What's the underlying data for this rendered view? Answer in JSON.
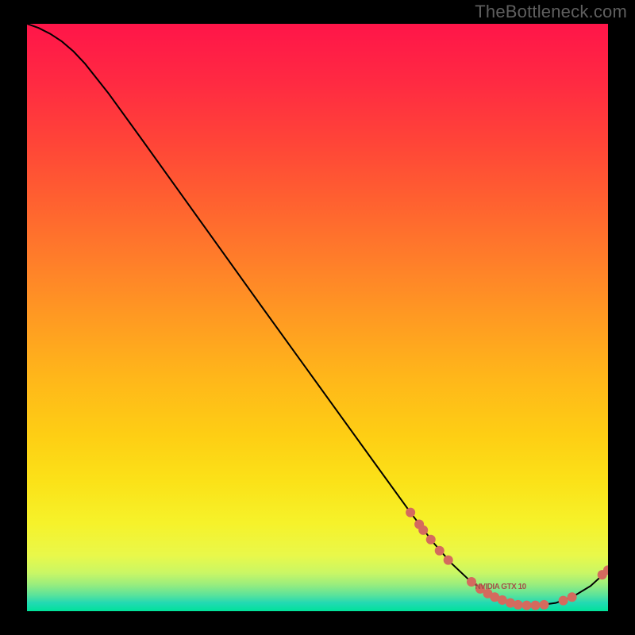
{
  "watermark": "TheBottleneck.com",
  "chart_data": {
    "type": "line",
    "title": "",
    "xlabel": "",
    "ylabel": "",
    "xlim": [
      0,
      100
    ],
    "ylim": [
      0,
      100
    ],
    "grid": false,
    "curve": [
      {
        "x": 0,
        "y": 100
      },
      {
        "x": 2,
        "y": 99.3
      },
      {
        "x": 4,
        "y": 98.3
      },
      {
        "x": 6,
        "y": 97.0
      },
      {
        "x": 8,
        "y": 95.3
      },
      {
        "x": 10,
        "y": 93.2
      },
      {
        "x": 14,
        "y": 88.2
      },
      {
        "x": 20,
        "y": 80.0
      },
      {
        "x": 30,
        "y": 66.2
      },
      {
        "x": 40,
        "y": 52.4
      },
      {
        "x": 50,
        "y": 38.7
      },
      {
        "x": 60,
        "y": 25.0
      },
      {
        "x": 66,
        "y": 16.8
      },
      {
        "x": 70,
        "y": 11.6
      },
      {
        "x": 73,
        "y": 8.2
      },
      {
        "x": 76,
        "y": 5.4
      },
      {
        "x": 79,
        "y": 3.2
      },
      {
        "x": 82,
        "y": 1.8
      },
      {
        "x": 85,
        "y": 1.1
      },
      {
        "x": 88,
        "y": 1.0
      },
      {
        "x": 91,
        "y": 1.4
      },
      {
        "x": 94,
        "y": 2.5
      },
      {
        "x": 97,
        "y": 4.3
      },
      {
        "x": 100,
        "y": 7.0
      }
    ],
    "dot_clusters": [
      {
        "cx": 66.0,
        "cy": 16.8,
        "r": 6
      },
      {
        "cx": 67.5,
        "cy": 14.8,
        "r": 6
      },
      {
        "cx": 68.2,
        "cy": 13.8,
        "r": 6
      },
      {
        "cx": 69.5,
        "cy": 12.2,
        "r": 6
      },
      {
        "cx": 71.0,
        "cy": 10.3,
        "r": 6
      },
      {
        "cx": 72.5,
        "cy": 8.7,
        "r": 6
      },
      {
        "cx": 76.5,
        "cy": 5.0,
        "r": 6
      },
      {
        "cx": 78.0,
        "cy": 3.8,
        "r": 6
      },
      {
        "cx": 79.3,
        "cy": 3.0,
        "r": 6
      },
      {
        "cx": 80.5,
        "cy": 2.4,
        "r": 6
      },
      {
        "cx": 81.8,
        "cy": 1.9,
        "r": 6
      },
      {
        "cx": 83.2,
        "cy": 1.4,
        "r": 6
      },
      {
        "cx": 84.5,
        "cy": 1.1,
        "r": 6
      },
      {
        "cx": 86.0,
        "cy": 1.0,
        "r": 6
      },
      {
        "cx": 87.5,
        "cy": 1.0,
        "r": 6
      },
      {
        "cx": 89.0,
        "cy": 1.1,
        "r": 6
      },
      {
        "cx": 92.3,
        "cy": 1.8,
        "r": 6
      },
      {
        "cx": 93.8,
        "cy": 2.4,
        "r": 6
      },
      {
        "cx": 99.0,
        "cy": 6.2,
        "r": 6
      },
      {
        "cx": 100.0,
        "cy": 7.0,
        "r": 6
      }
    ],
    "label_on_curve": {
      "x": 81.5,
      "y": 3.8,
      "text": "NVIDIA GTX 10"
    },
    "gradient_stops": [
      {
        "offset": 0.0,
        "color": "#ff1549"
      },
      {
        "offset": 0.1,
        "color": "#ff2a42"
      },
      {
        "offset": 0.2,
        "color": "#ff4438"
      },
      {
        "offset": 0.3,
        "color": "#ff6030"
      },
      {
        "offset": 0.4,
        "color": "#ff7d2a"
      },
      {
        "offset": 0.5,
        "color": "#ff9a22"
      },
      {
        "offset": 0.6,
        "color": "#ffb61a"
      },
      {
        "offset": 0.7,
        "color": "#fece14"
      },
      {
        "offset": 0.78,
        "color": "#fbe218"
      },
      {
        "offset": 0.85,
        "color": "#f6f22a"
      },
      {
        "offset": 0.905,
        "color": "#e9f84a"
      },
      {
        "offset": 0.935,
        "color": "#c9f765"
      },
      {
        "offset": 0.955,
        "color": "#98ed7e"
      },
      {
        "offset": 0.972,
        "color": "#5de39a"
      },
      {
        "offset": 0.986,
        "color": "#22d9b3"
      },
      {
        "offset": 1.0,
        "color": "#00e29a"
      }
    ],
    "dot_color": "#d46a5e",
    "curve_color": "#000000",
    "label_color": "#a35148"
  }
}
